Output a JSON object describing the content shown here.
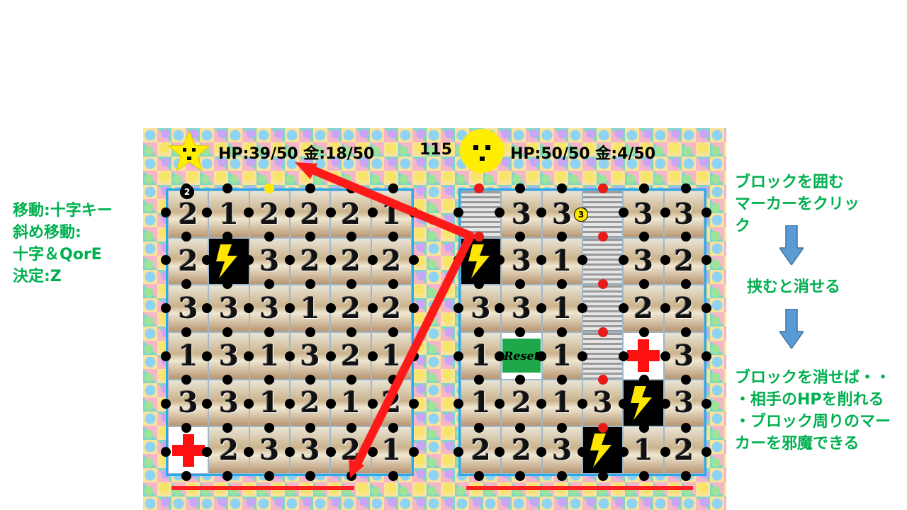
{
  "instructions_left": [
    "移動:十字キー",
    "斜め移動:",
    "十字＆QorE",
    "決定:Z"
  ],
  "instructions_right": {
    "step1": [
      "ブロックを囲む",
      "マーカーをクリッ",
      "ク"
    ],
    "step2": "挟むと消せる",
    "step3": [
      "ブロックを消せば・・",
      "・相手のHPを削れる",
      "・ブロック周りのマー",
      "カーを邪魔できる"
    ]
  },
  "player1": {
    "hp": "HP:39/50",
    "gold": "金:18/50",
    "icon": "star-face-icon"
  },
  "turn_counter": "115",
  "player2": {
    "hp": "HP:50/50",
    "gold": "金:4/50",
    "icon": "circle-face-icon"
  },
  "left_grid": [
    [
      "2",
      "1",
      "2",
      "2",
      "2",
      "1"
    ],
    [
      "2",
      "bolt",
      "3",
      "2",
      "2",
      "2"
    ],
    [
      "3",
      "3",
      "3",
      "1",
      "2",
      "2"
    ],
    [
      "1",
      "3",
      "1",
      "3",
      "2",
      "1"
    ],
    [
      "3",
      "3",
      "1",
      "2",
      "1",
      "2"
    ],
    [
      "heal",
      "2",
      "3",
      "3",
      "2",
      "1"
    ]
  ],
  "right_grid": [
    [
      "stripe",
      "3",
      "3",
      "stripe",
      "3",
      "3"
    ],
    [
      "bolt",
      "3",
      "1",
      "stripe",
      "3",
      "2"
    ],
    [
      "3",
      "3",
      "1",
      "stripe",
      "2",
      "2"
    ],
    [
      "1",
      "reset",
      "1",
      "stripe",
      "heal",
      "3"
    ],
    [
      "1",
      "2",
      "1",
      "3",
      "bolt",
      "3"
    ],
    [
      "2",
      "2",
      "3",
      "bolt",
      "1",
      "2"
    ]
  ],
  "reset_label": "Reset",
  "left_badge": "2",
  "right_badge": "3",
  "colors": {
    "accent_green": "#00b050",
    "grid_border": "#2aa8e8",
    "line_red": "#ff1a1a"
  }
}
